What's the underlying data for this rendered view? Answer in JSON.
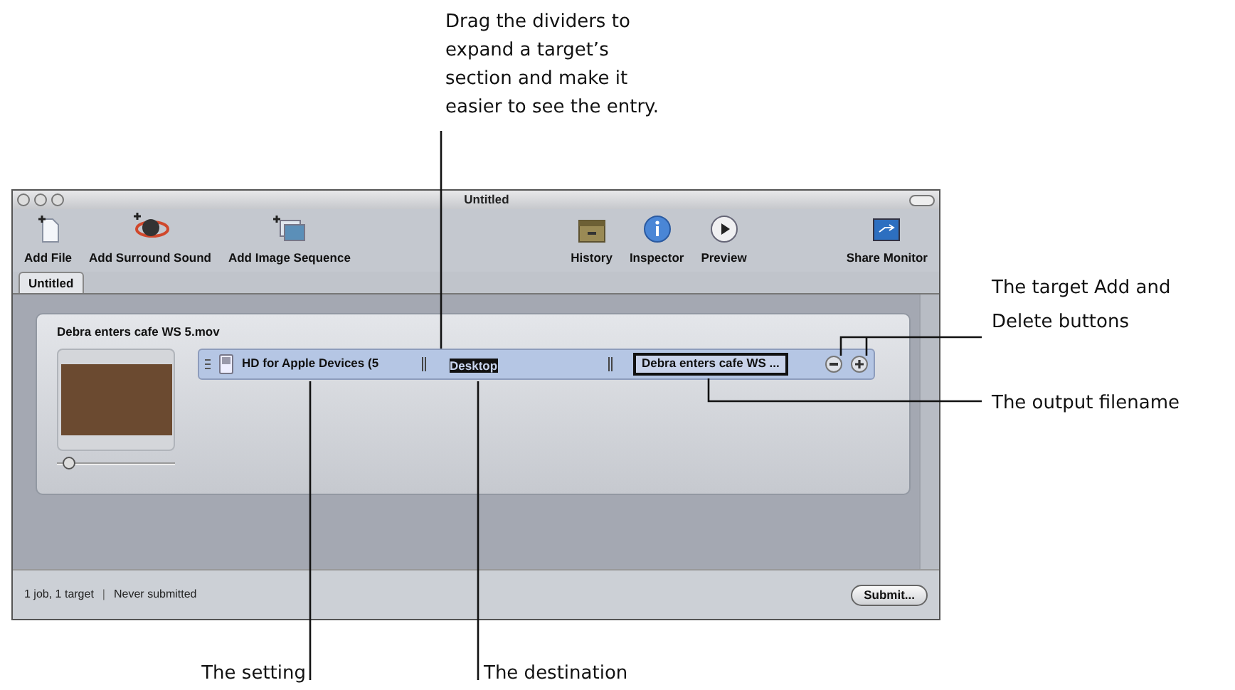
{
  "window": {
    "title": "Untitled"
  },
  "toolbar": {
    "left": [
      {
        "label": "Add File",
        "kind": "file"
      },
      {
        "label": "Add Surround Sound",
        "kind": "sound"
      },
      {
        "label": "Add Image Sequence",
        "kind": "images"
      }
    ],
    "right": [
      {
        "label": "History",
        "kind": "history"
      },
      {
        "label": "Inspector",
        "kind": "inspector"
      },
      {
        "label": "Preview",
        "kind": "preview"
      }
    ],
    "far_right": [
      {
        "label": "Share Monitor",
        "kind": "monitor"
      }
    ]
  },
  "tabs": [
    {
      "label": "Untitled",
      "selected": true
    }
  ],
  "job": {
    "name": "Debra enters cafe WS 5.mov",
    "slider": {
      "level": 0.05
    },
    "target": {
      "setting": "HD for Apple Devices (5",
      "destination": "Desktop",
      "destination_selected": true,
      "filename": "Debra enters cafe WS ..."
    }
  },
  "status_bar": {
    "jobs": "1 job, 1 target",
    "separator": "|",
    "state": "Never submitted",
    "button": "Submit..."
  },
  "callouts": [
    {
      "text": "Drag the dividers to expand a target’s section and make it easier to see the entry.",
      "kind": "top"
    },
    {
      "text": "The target Add and Delete buttons",
      "kind": "buttons"
    },
    {
      "text": "The output filename",
      "kind": "filename"
    },
    {
      "text": "The setting",
      "kind": "setting"
    },
    {
      "text": "The destination",
      "kind": "destination"
    }
  ]
}
